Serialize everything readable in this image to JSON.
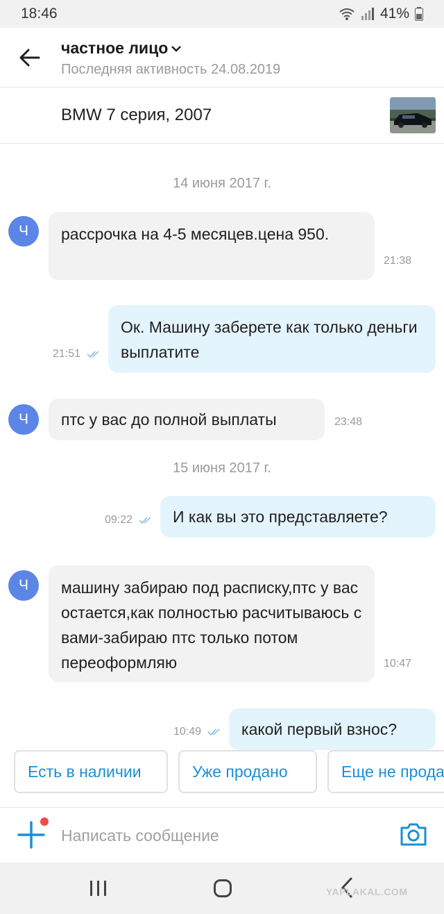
{
  "status_bar": {
    "time": "18:46",
    "battery": "41%"
  },
  "header": {
    "title": "частное лицо",
    "subtitle": "Последняя активность 24.08.2019"
  },
  "listing": {
    "title": "BMW 7 серия, 2007"
  },
  "avatar_initial": "Ч",
  "messages": [
    {
      "type": "date",
      "text": "14 июня 2017 г."
    },
    {
      "type": "in",
      "text": "рассрочка на 4-5 месяцев.цена 950.",
      "time": "21:38"
    },
    {
      "type": "out",
      "text": "Ок. Машину заберете как только деньги выплатите",
      "time": "21:51"
    },
    {
      "type": "in",
      "text": "птс у вас до полной выплаты",
      "time": "23:48"
    },
    {
      "type": "date",
      "text": "15 июня 2017 г."
    },
    {
      "type": "out",
      "text": "И как вы это представляете?",
      "time": "09:22"
    },
    {
      "type": "in",
      "text": "машину забираю под расписку,птс у вас остается,как полностью расчитываюсь с вами-забираю птс только потом переоформляю",
      "time": "10:47"
    },
    {
      "type": "out",
      "text": "какой первый взнос?",
      "time": "10:49"
    }
  ],
  "quick_replies": [
    "Есть в наличии",
    "Уже продано",
    "Еще не продано"
  ],
  "composer": {
    "placeholder": "Написать сообщение"
  },
  "watermark": "YAPLAKAL.COM",
  "colors": {
    "accent": "#1a8fd6",
    "avatar": "#5b86e5",
    "incoming_bubble": "#f2f2f2",
    "outgoing_bubble": "#e4f4fd",
    "notification_dot": "#f04b4b"
  }
}
